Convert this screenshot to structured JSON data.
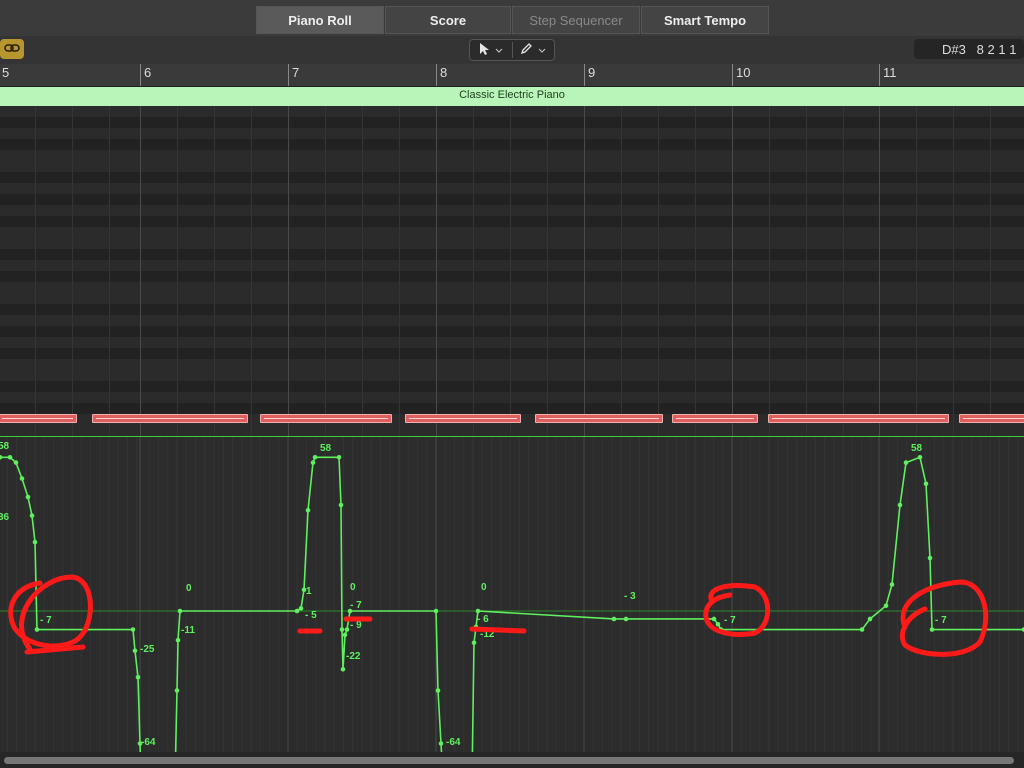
{
  "tabs": [
    {
      "label": "Piano Roll",
      "state": "active"
    },
    {
      "label": "Score",
      "state": "normal"
    },
    {
      "label": "Step Sequencer",
      "state": "disabled"
    },
    {
      "label": "Smart Tempo",
      "state": "normal"
    }
  ],
  "toolbar": {
    "link_icon": "link-icon",
    "pointer_tool_icon": "pointer-icon",
    "pencil_tool_icon": "pencil-icon",
    "dropdown_icon": "chevron-down-icon",
    "position_display": "D#3   8 2 1 1"
  },
  "ruler": {
    "bars": [
      "5",
      "6",
      "7",
      "8",
      "9",
      "10",
      "11"
    ]
  },
  "region": {
    "name": "Classic Electric Piano",
    "color": "#b9f5b9"
  },
  "notes": {
    "count": 8,
    "color": "#e06060"
  },
  "automation": {
    "line_color": "#5ef05e",
    "annotation_color": "#ff1a1a",
    "value_labels": [
      "58",
      "36",
      "- 7",
      "-25",
      "-64",
      "0",
      "-11",
      "58",
      "1",
      "- 5",
      "0",
      "- 7",
      "- 9",
      "-22",
      "-64",
      "0",
      "- 6",
      "-12",
      "- 3",
      "- 7",
      "58",
      "- 7"
    ]
  }
}
